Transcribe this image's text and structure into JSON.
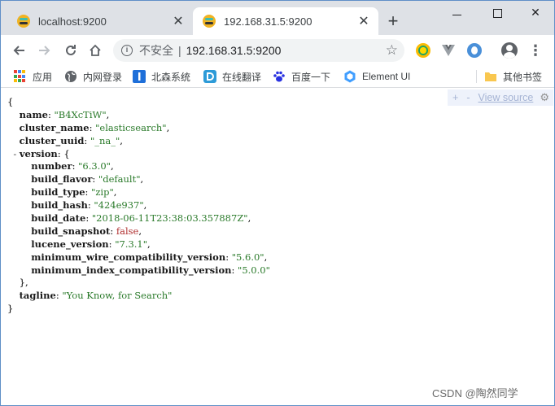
{
  "window": {
    "controls": {
      "close_glyph": "✕"
    }
  },
  "tabs": [
    {
      "title": "localhost:9200",
      "close_glyph": "✕",
      "active": false
    },
    {
      "title": "192.168.31.5:9200",
      "close_glyph": "✕",
      "active": true
    }
  ],
  "new_tab_glyph": "+",
  "toolbar": {
    "insecure_label": "不安全",
    "separator": "|",
    "url": "192.168.31.5:9200"
  },
  "bookmarks": {
    "items": [
      {
        "label": "应用",
        "icon": "apps-grid-icon"
      },
      {
        "label": "内网登录",
        "icon": "globe-icon"
      },
      {
        "label": "北森系统",
        "icon": "beisen-icon"
      },
      {
        "label": "在线翻译",
        "icon": "translate-icon"
      },
      {
        "label": "百度一下",
        "icon": "baidu-paw-icon"
      },
      {
        "label": "Element UI",
        "icon": "element-ui-icon"
      }
    ],
    "other_label": "其他书签"
  },
  "json_viewer": {
    "toolbar": {
      "expand": "+",
      "collapse": "-",
      "view_source": "View source",
      "gear_glyph": "⚙"
    },
    "open_brace": "{",
    "close_brace": "}",
    "fields": [
      {
        "key": "name",
        "value": "\"B4XcTiW\""
      },
      {
        "key": "cluster_name",
        "value": "\"elasticsearch\""
      },
      {
        "key": "cluster_uuid",
        "value": "\"_na_\""
      }
    ],
    "version_key": "version",
    "version_toggle": "-",
    "version_fields": [
      {
        "key": "number",
        "value": "\"6.3.0\""
      },
      {
        "key": "build_flavor",
        "value": "\"default\""
      },
      {
        "key": "build_type",
        "value": "\"zip\""
      },
      {
        "key": "build_hash",
        "value": "\"424e937\""
      },
      {
        "key": "build_date",
        "value": "\"2018-06-11T23:38:03.357887Z\""
      },
      {
        "key": "build_snapshot",
        "value": "false"
      },
      {
        "key": "lucene_version",
        "value": "\"7.3.1\""
      },
      {
        "key": "minimum_wire_compatibility_version",
        "value": "\"5.6.0\""
      },
      {
        "key": "minimum_index_compatibility_version",
        "value": "\"5.0.0\""
      }
    ],
    "version_close": "},",
    "tagline_key": "tagline",
    "tagline_value": "\"You Know, for Search\""
  },
  "watermark": "CSDN @陶然同学",
  "colors": {
    "tabstrip": "#dee1e6",
    "string_value": "#2a7a2a",
    "boolean_value": "#b03030",
    "view_source_link": "#a6b4d4"
  }
}
